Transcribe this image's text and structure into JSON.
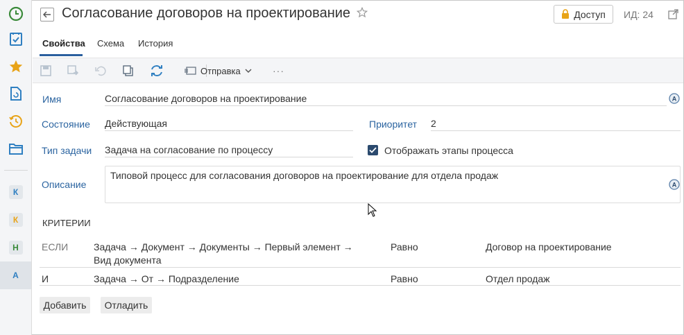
{
  "header": {
    "title": "Согласование договоров на проектирование",
    "access_label": "Доступ",
    "id_label": "ИД: 24"
  },
  "tabs": [
    {
      "label": "Свойства",
      "active": true
    },
    {
      "label": "Схема",
      "active": false
    },
    {
      "label": "История",
      "active": false
    }
  ],
  "toolbar": {
    "send_label": "Отправка",
    "more_label": "···"
  },
  "rail": {
    "letters": [
      "К",
      "К",
      "Н",
      "А"
    ]
  },
  "form": {
    "name_label": "Имя",
    "name_value": "Согласование договоров на проектирование",
    "state_label": "Состояние",
    "state_value": "Действующая",
    "priority_label": "Приоритет",
    "priority_value": "2",
    "task_type_label": "Тип задачи",
    "task_type_value": "Задача на согласование по процессу",
    "show_stages_label": "Отображать этапы процесса",
    "show_stages_checked": true,
    "description_label": "Описание",
    "description_value": "Типовой процесс для согласования договоров на проектирование для отдела продаж"
  },
  "criteria": {
    "section_label": "КРИТЕРИИ",
    "rows": [
      {
        "keyword": "ЕСЛИ",
        "path_line1": "Задача → Документ → Документы → Первый элемент →",
        "path_line2": "Вид документа",
        "operator": "Равно",
        "value": "Договор на проектирование"
      },
      {
        "keyword": "И",
        "path_line1": "Задача → От → Подразделение",
        "path_line2": "",
        "operator": "Равно",
        "value": "Отдел продаж"
      }
    ]
  },
  "actions": {
    "add_label": "Добавить",
    "debug_label": "Отладить"
  },
  "colors": {
    "accent": "#2b64a0",
    "rail_bg": "#f4f5f7",
    "tab_underline": "#2b5f9e",
    "green_icon": "#3a8a3a",
    "yellow_icon": "#e8a317",
    "blue_icon": "#2f7fc1"
  }
}
